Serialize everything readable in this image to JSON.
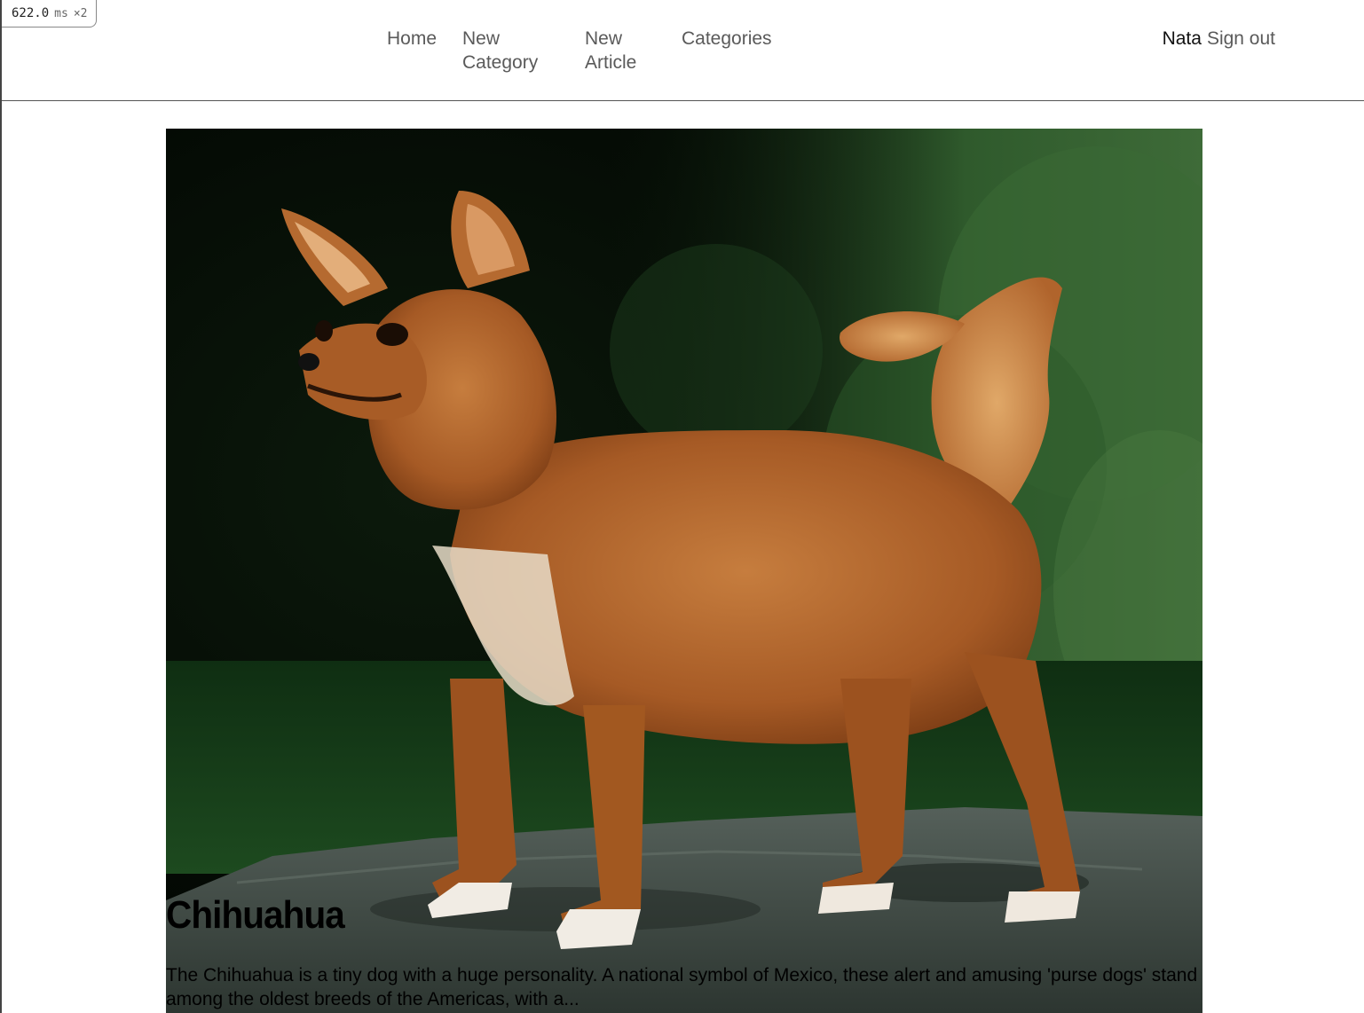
{
  "timing": {
    "value": "622.0",
    "unit": "ms",
    "multiplier": "×2"
  },
  "nav": {
    "home": "Home",
    "new_category": "New Category",
    "new_article": "New Article",
    "categories": "Categories"
  },
  "user": {
    "name": "Nata",
    "sign_out": "Sign out"
  },
  "feature": {
    "image_subject": "chihuahua-photo",
    "title": "Chihuahua",
    "excerpt": "The Chihuahua is a tiny dog with a huge personality. A national symbol of Mexico, these alert and amusing 'purse dogs' stand among the oldest breeds of the Americas, with a..."
  }
}
